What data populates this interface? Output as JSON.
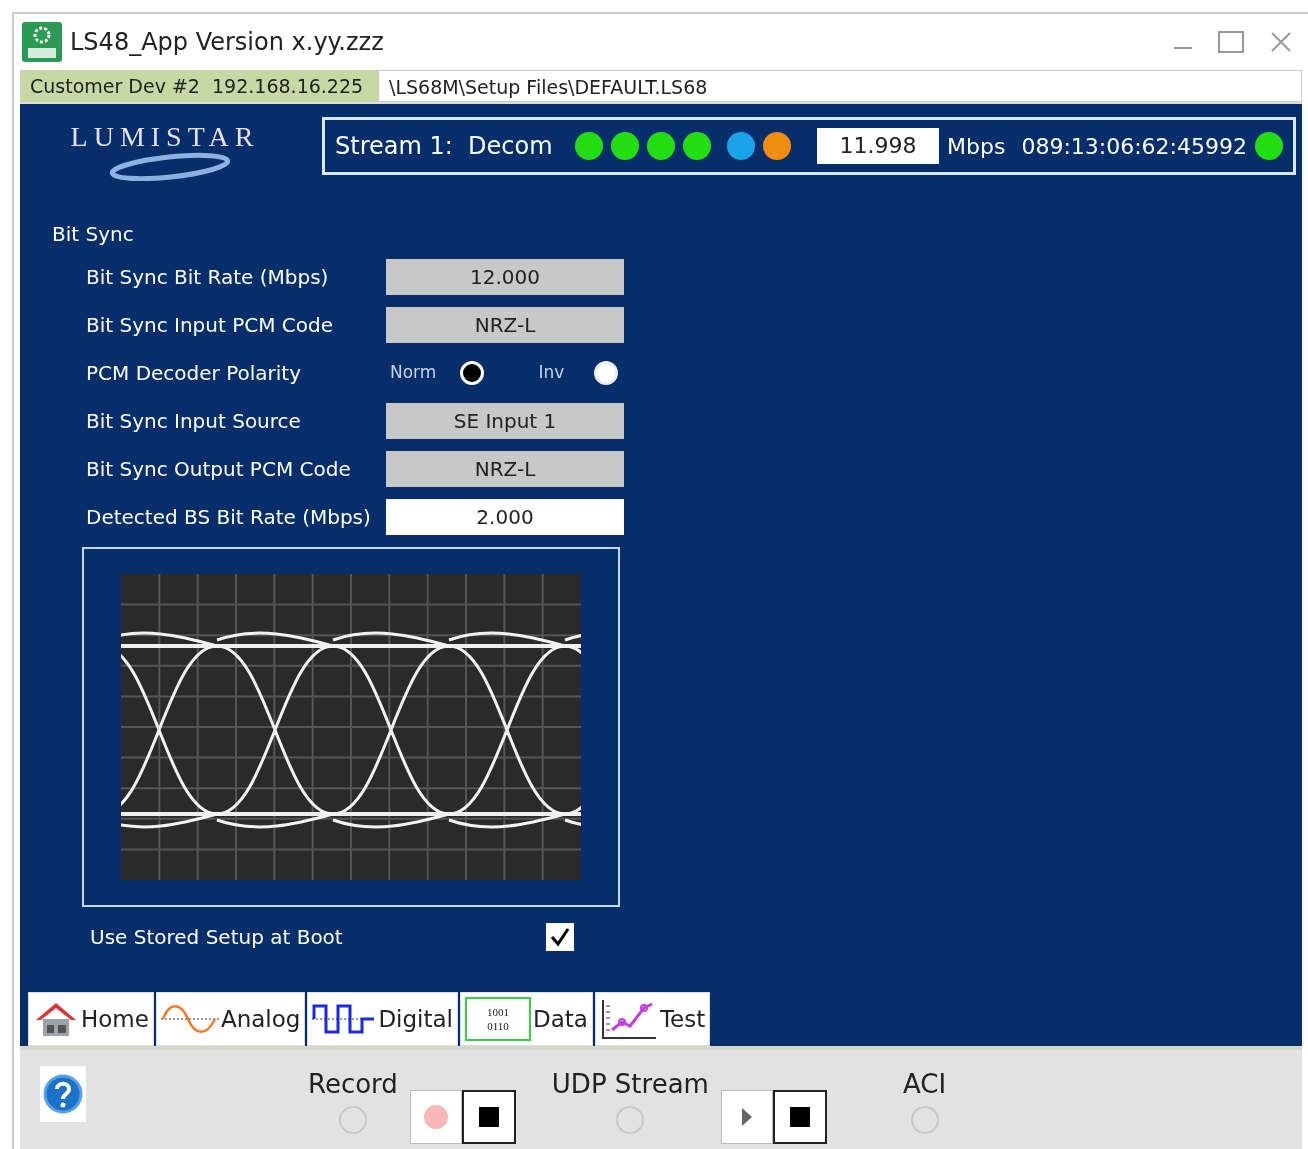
{
  "window": {
    "title": "LS48_App Version x.yy.zzz"
  },
  "device_bar": {
    "device": "Customer Dev #2  192.168.16.225",
    "path": "\\LS68M\\Setup Files\\DEFAULT.LS68"
  },
  "logo": {
    "text": "LUMISTAR"
  },
  "stream": {
    "label": "Stream 1:  Decom",
    "indicators": [
      {
        "color": "#22dd11"
      },
      {
        "color": "#22dd11"
      },
      {
        "color": "#22dd11"
      },
      {
        "color": "#22dd11"
      },
      {
        "color": "#1aa3e8"
      },
      {
        "color": "#f08c10"
      }
    ],
    "rate": "11.998",
    "unit": "Mbps",
    "time": "089:13:06:62:45992",
    "time_indicator": {
      "color": "#22dd11"
    }
  },
  "section": {
    "title": "Bit Sync"
  },
  "settings": [
    {
      "kind": "select",
      "label": "Bit Sync Bit Rate (Mbps)",
      "value": "12.000"
    },
    {
      "kind": "select",
      "label": "Bit Sync Input PCM Code",
      "value": "NRZ-L"
    },
    {
      "kind": "radio",
      "label": "PCM Decoder Polarity",
      "options": [
        {
          "label": "Norm",
          "selected": true
        },
        {
          "label": "Inv",
          "selected": false
        }
      ]
    },
    {
      "kind": "select",
      "label": "Bit Sync Input Source",
      "value": "SE Input 1"
    },
    {
      "kind": "select",
      "label": "Bit Sync Output PCM Code",
      "value": "NRZ-L"
    },
    {
      "kind": "readout",
      "label": "Detected BS Bit Rate (Mbps)",
      "value": "2.000"
    }
  ],
  "boot_option": {
    "label": "Use Stored Setup at Boot",
    "checked": true
  },
  "tabs": [
    {
      "kind": "home",
      "label": "Home",
      "selected": false
    },
    {
      "kind": "analog",
      "label": "Analog",
      "selected": false
    },
    {
      "kind": "digital",
      "label": "Digital",
      "selected": false
    },
    {
      "kind": "data",
      "label": "Data",
      "icon_text": [
        "1001",
        "0110"
      ],
      "selected": false
    },
    {
      "kind": "test",
      "label": "Test",
      "selected": false
    }
  ],
  "controls": [
    {
      "kind": "record",
      "label": "Record"
    },
    {
      "kind": "stream",
      "label": "UDP Stream"
    },
    {
      "kind": "light",
      "label": "ACI"
    }
  ]
}
